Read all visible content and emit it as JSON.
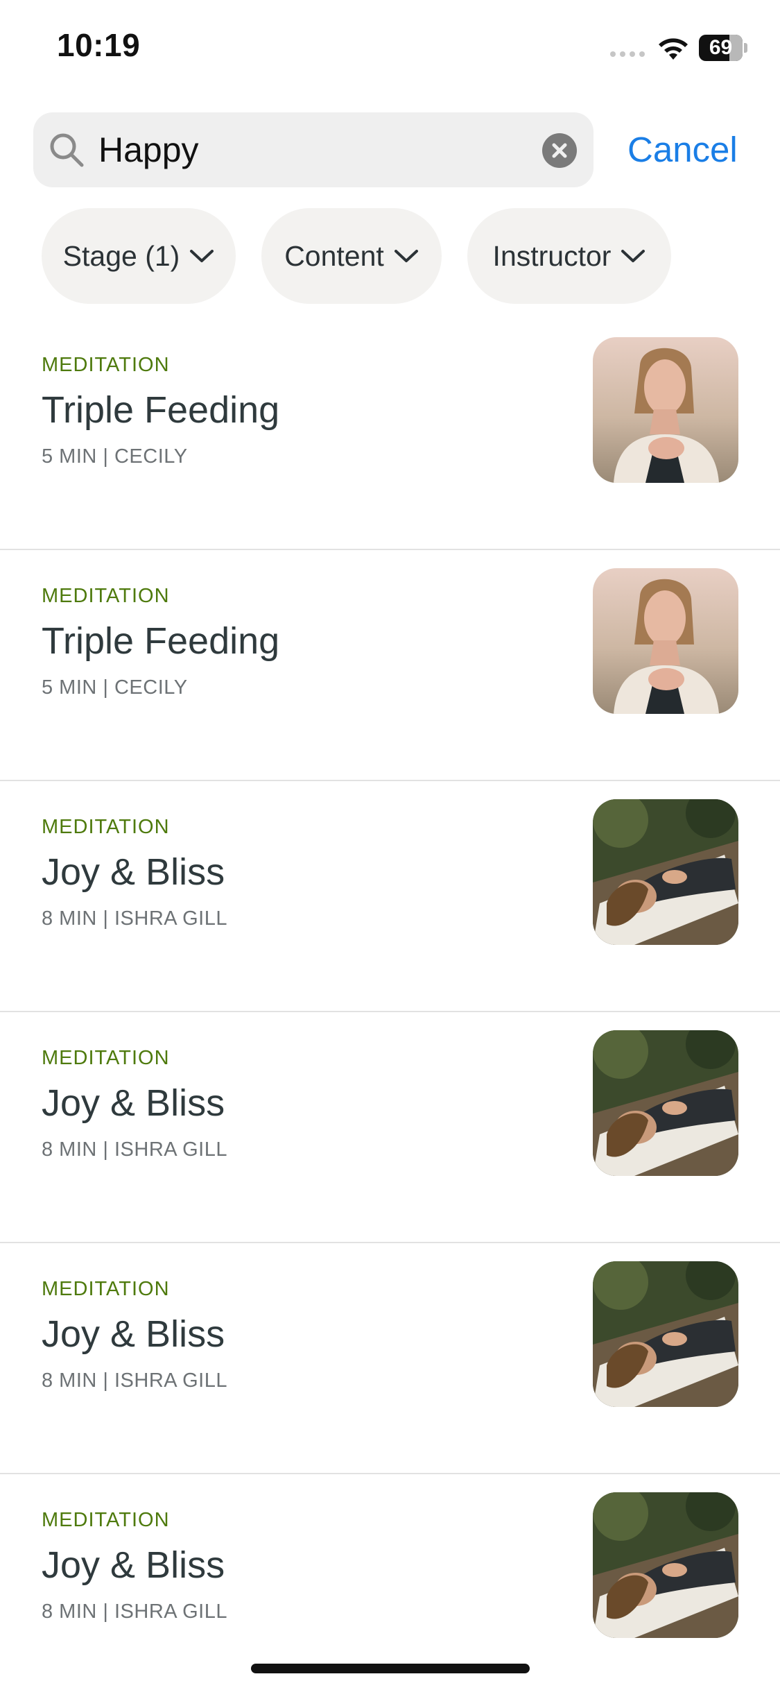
{
  "status_bar": {
    "time": "10:19",
    "battery": "69"
  },
  "search": {
    "value": "Happy",
    "cancel_label": "Cancel"
  },
  "filters": [
    {
      "label": "Stage (1)"
    },
    {
      "label": "Content"
    },
    {
      "label": "Instructor"
    }
  ],
  "results": [
    {
      "category": "MEDITATION",
      "title": "Triple Feeding",
      "meta": "5 MIN | CECILY",
      "image": "woman-hand-on-chest"
    },
    {
      "category": "MEDITATION",
      "title": "Triple Feeding",
      "meta": "5 MIN | CECILY",
      "image": "woman-hand-on-chest"
    },
    {
      "category": "MEDITATION",
      "title": "Joy & Bliss",
      "meta": "8 MIN | ISHRA GILL",
      "image": "woman-lying-on-blanket"
    },
    {
      "category": "MEDITATION",
      "title": "Joy & Bliss",
      "meta": "8 MIN | ISHRA GILL",
      "image": "woman-lying-on-blanket"
    },
    {
      "category": "MEDITATION",
      "title": "Joy & Bliss",
      "meta": "8 MIN | ISHRA GILL",
      "image": "woman-lying-on-blanket"
    },
    {
      "category": "MEDITATION",
      "title": "Joy & Bliss",
      "meta": "8 MIN | ISHRA GILL",
      "image": "woman-lying-on-blanket"
    }
  ],
  "colors": {
    "accent": "#1a7ee6",
    "category": "#4e7a0d",
    "chip_bg": "#f3f2f0",
    "search_bg": "#efefef"
  }
}
